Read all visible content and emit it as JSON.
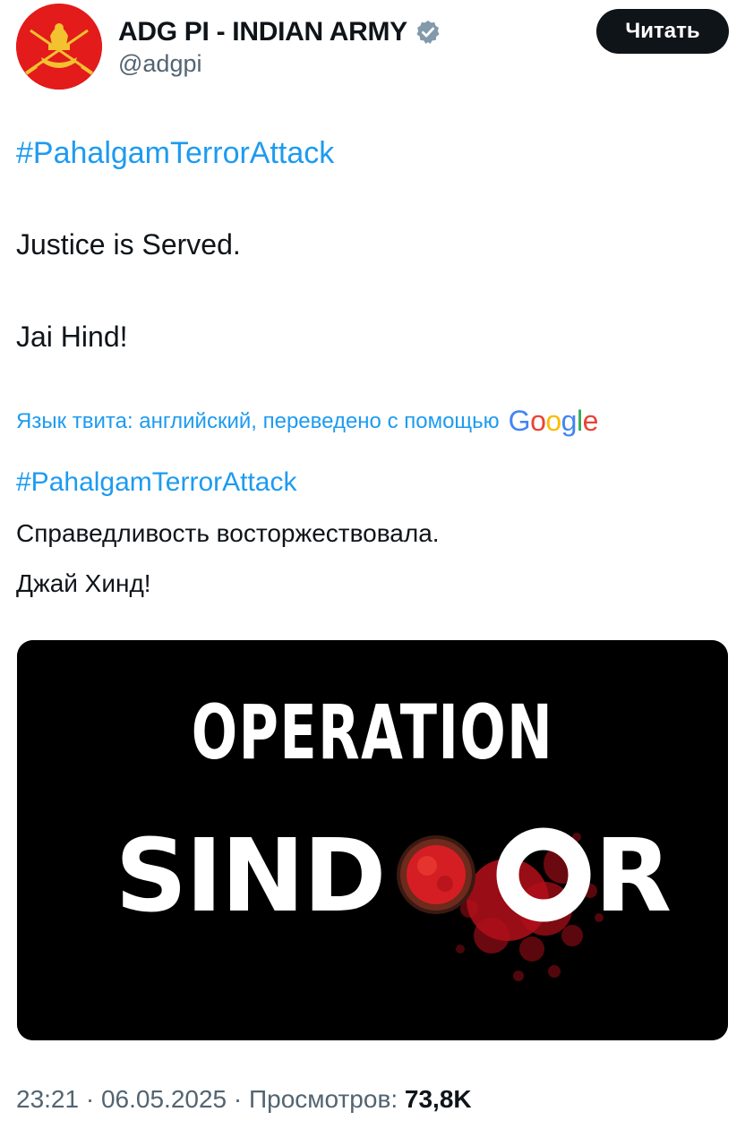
{
  "author": {
    "display_name": "ADG PI - INDIAN ARMY",
    "handle": "@adgpi",
    "avatar_icon": "indian-army-emblem-icon",
    "verified_icon": "verified-badge-icon",
    "avatar_color": "#e31b1b"
  },
  "follow_button": {
    "label": "Читать"
  },
  "tweet": {
    "hashtag": "#PahalgamTerrorAttack",
    "line1": "Justice is Served.",
    "line2": "Jai Hind!"
  },
  "translation": {
    "note": "Язык твита: английский, переведено с помощью",
    "provider": "Google",
    "hashtag": "#PahalgamTerrorAttack",
    "line1": "Справедливость восторжествовала.",
    "line2": "Джай Хинд!"
  },
  "media": {
    "line1": "OPERATION",
    "line2_part1": "SIND",
    "line2_part2": "OR",
    "accent_color": "#c4141e"
  },
  "meta": {
    "time": "23:21",
    "separator": "·",
    "date": "06.05.2025",
    "views_label": "Просмотров:",
    "views_count": "73,8K"
  },
  "colors": {
    "link": "#1d9bf0",
    "text": "#0f1419",
    "secondary": "#536471"
  }
}
